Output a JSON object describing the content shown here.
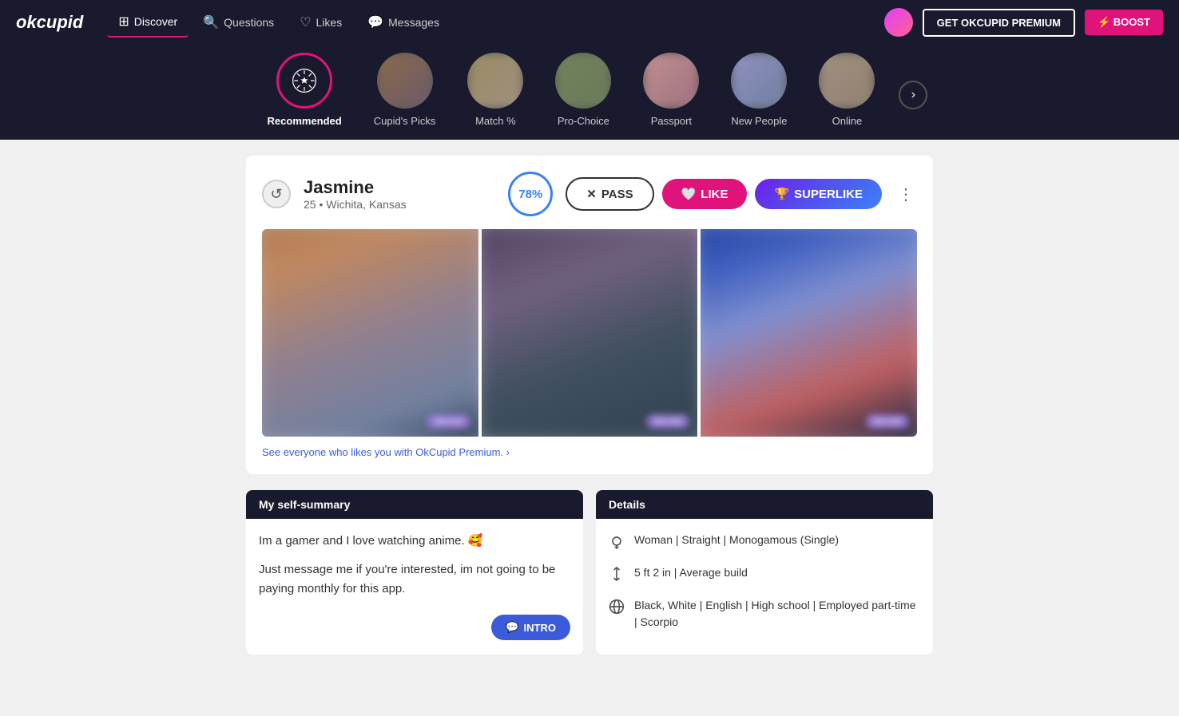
{
  "logo": "okcupid",
  "nav": {
    "items": [
      {
        "id": "discover",
        "label": "Discover",
        "icon": "⊞",
        "active": true
      },
      {
        "id": "questions",
        "label": "Questions",
        "icon": "❓"
      },
      {
        "id": "likes",
        "label": "Likes",
        "icon": "♡"
      },
      {
        "id": "messages",
        "label": "Messages",
        "icon": "💬"
      }
    ],
    "premium_label": "GET OKCUPID PREMIUM",
    "boost_label": "⚡ BOOST"
  },
  "discover_tabs": [
    {
      "id": "recommended",
      "label": "Recommended",
      "active": true
    },
    {
      "id": "cupids_picks",
      "label": "Cupid's Picks"
    },
    {
      "id": "match",
      "label": "Match %"
    },
    {
      "id": "pro_choice",
      "label": "Pro-Choice"
    },
    {
      "id": "passport",
      "label": "Passport"
    },
    {
      "id": "new_people",
      "label": "New People"
    },
    {
      "id": "online",
      "label": "Online"
    }
  ],
  "profile": {
    "name": "Jasmine",
    "age": "25",
    "location": "Wichita, Kansas",
    "match_percent": "78%",
    "pass_label": "PASS",
    "like_label": "LIKE",
    "superlike_label": "SUPERLIKE",
    "premium_prompt": "See everyone who likes you with OkCupid Premium. ›",
    "self_summary_header": "My self-summary",
    "self_summary_line1": "Im a gamer and I love watching anime. 🥰",
    "self_summary_line2": "Just message me if you're interested, im not going to be paying monthly for this app.",
    "intro_label": "INTRO",
    "details_header": "Details",
    "details": [
      {
        "icon": "♀",
        "text": "Woman | Straight | Monogamous (Single)"
      },
      {
        "icon": "↕",
        "text": "5 ft 2 in | Average build"
      },
      {
        "icon": "🌐",
        "text": "Black, White | English | High school | Employed part-time | Scorpio"
      }
    ]
  }
}
